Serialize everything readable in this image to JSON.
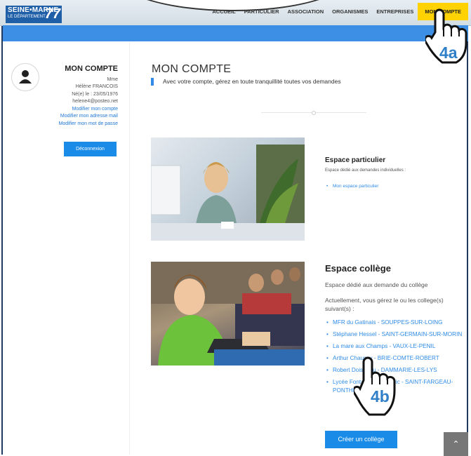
{
  "header": {
    "logo_line1": "SEINE•MARNE",
    "logo_line2": "LE DÉPARTEMENT",
    "logo_number": "77",
    "nav": [
      "ACCUEIL",
      "PARTICULIER",
      "ASSOCIATION",
      "ORGANISMES",
      "ENTREPRISES",
      "MON COMPTE"
    ]
  },
  "sidebar": {
    "title": "MON COMPTE",
    "civility": "Mme",
    "name": "Hélène FRANCOIS",
    "birth": "Né(e) le : 23/05/1976",
    "email": "helene4@posteo.net",
    "links": [
      "Modifier mon compte",
      "Modifier mon adresse mail",
      "Modifier mon mot de passe"
    ],
    "logout": "Déconnexion"
  },
  "main": {
    "title": "MON COMPTE",
    "lead": "Avec votre compte, gérez en toute tranquillité toutes vos demandes",
    "particulier": {
      "title": "Espace particulier",
      "desc": "Espace dédié aux demandes individuelles :",
      "link": "Mon espace particulier"
    },
    "college": {
      "title": "Espace collège",
      "desc": "Espace dédié aux demande du collège",
      "intro": "Actuellement, vous gérez le ou les college(s) suivant(s) :",
      "items": [
        "MFR du Gatinais - SOUPPES-SUR-LOING",
        "Stéphane Hessel - SAINT-GERMAIN-SUR-MORIN",
        "La mare aux Champs - VAUX-LE-PENIL",
        "Arthur Chaussy - BRIE-COMTE-ROBERT",
        "Robert Doisneau - DAMMARIE-LES-LYS",
        "Lycée Fontaine Sainte-Nic - SAINT-FARGEAU-PONTHIERRY"
      ],
      "create": "Créer un collège"
    }
  },
  "annotations": {
    "a": "4a",
    "b": "4b"
  },
  "colors": {
    "brand_blue": "#3d8fe6",
    "button_blue": "#1a8ce8",
    "active_nav": "#ffd200",
    "label_blue": "#2f7fc9"
  }
}
